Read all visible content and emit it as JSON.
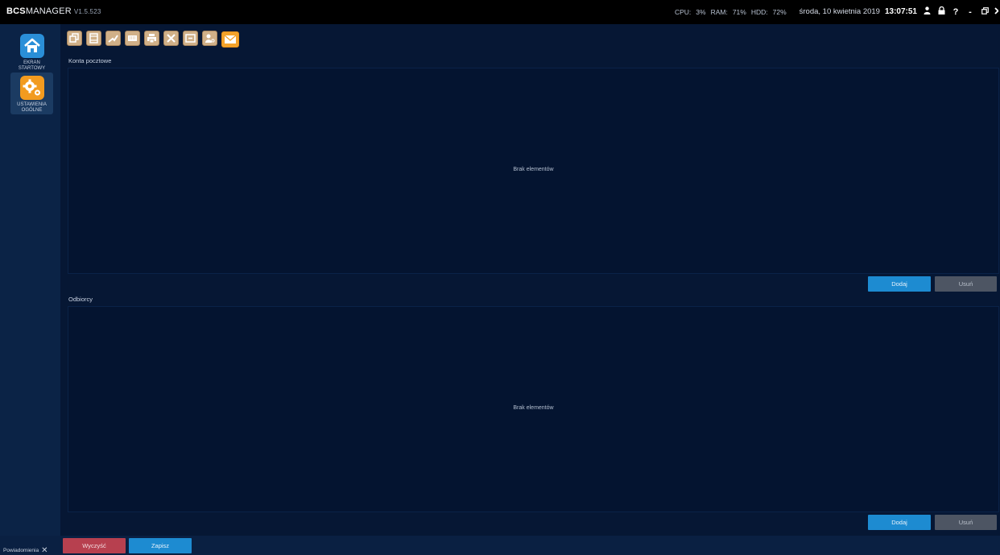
{
  "titlebar": {
    "brand_bold": "BCS",
    "brand_rest": "MANAGER",
    "version": "V1.5.523",
    "cpu_label": "CPU:",
    "cpu_value": "3%",
    "ram_label": "RAM:",
    "ram_value": "71%",
    "hdd_label": "HDD:",
    "hdd_value": "72%",
    "date": "środa, 10 kwietnia 2019",
    "time": "13:07:51",
    "help_label": "?",
    "minimize_label": "-"
  },
  "sidebar": {
    "items": [
      {
        "label_line1": "EKRAN",
        "label_line2": "STARTOWY"
      },
      {
        "label_line1": "USTAWIENIA",
        "label_line2": "OGÓLNE"
      }
    ]
  },
  "toolbar": {
    "icons": [
      "windows-icon",
      "film-icon",
      "arrow-icon",
      "keyboard-icon",
      "printer-icon",
      "tools-icon",
      "panel-icon",
      "user-key-icon",
      "mail-icon"
    ]
  },
  "sections": {
    "mail_accounts": {
      "title": "Konta pocztowe",
      "empty_text": "Brak elementów",
      "add_label": "Dodaj",
      "remove_label": "Usuń"
    },
    "recipients": {
      "title": "Odbiorcy",
      "empty_text": "Brak elementów",
      "add_label": "Dodaj",
      "remove_label": "Usuń"
    }
  },
  "footer": {
    "clear_label": "Wyczyść",
    "save_label": "Zapisz",
    "notifications_label": "Powiadomienia"
  },
  "colors": {
    "accent_blue": "#1d8bd1",
    "danger_red": "#b7404f",
    "background": "#061734",
    "toolbar_icon": "#d0b088",
    "mail_icon": "#f3a22b"
  }
}
